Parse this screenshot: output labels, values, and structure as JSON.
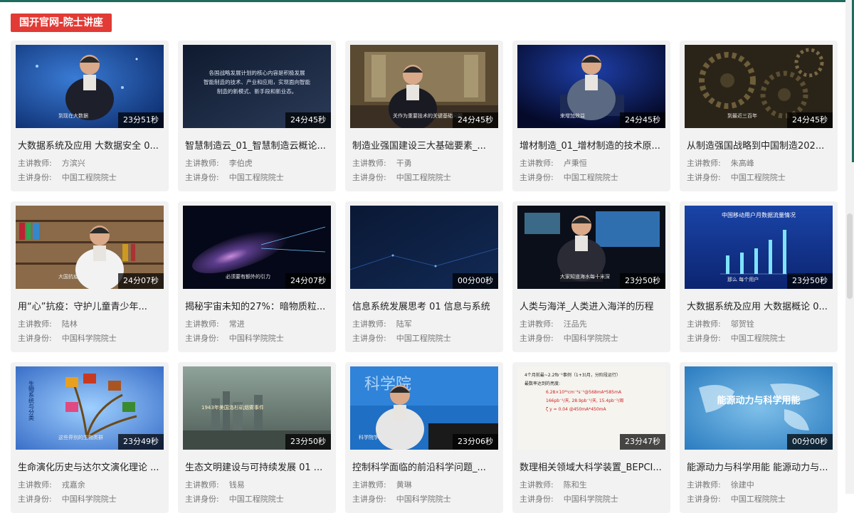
{
  "section": {
    "title": "国开官网-院士讲座"
  },
  "labels": {
    "teacher": "主讲教师:",
    "identity": "主讲身份:"
  },
  "videos": [
    {
      "title": "大数据系统及应用 大数据安全 0...",
      "teacher": "方滨兴",
      "identity": "中国工程院院士",
      "duration": "23分51秒",
      "caption": "到现在大数据",
      "scene": "anchor-blue"
    },
    {
      "title": "智慧制造云_01_智慧制造云概论...",
      "teacher": "李伯虎",
      "identity": "中国工程院院士",
      "duration": "24分45秒",
      "scene": "text-dark",
      "overlay_lines": [
        "各国战略发展计划的核心内容是积极发展",
        "智能制造的技术、产业和应用，实现面向智能",
        "制造的新模式、新手段和新业态。"
      ]
    },
    {
      "title": "制造业强国建设三大基础要素_...",
      "teacher": "干勇",
      "identity": "中国工程院院士",
      "duration": "24分45秒",
      "caption": "关作为重要技术的关键基础问题",
      "scene": "interview-hall"
    },
    {
      "title": "增材制造_01_增材制造的技术原...",
      "teacher": "卢秉恒",
      "identity": "中国工程院院士",
      "duration": "24分45秒",
      "caption": "来增加效益",
      "scene": "studio-blue"
    },
    {
      "title": "从制造强国战略到中国制造202...",
      "teacher": "朱高峰",
      "identity": "中国工程院院士",
      "duration": "24分45秒",
      "caption": "到最近三百年",
      "scene": "gears"
    },
    {
      "title": "用“心”抗疫：守护儿童青少年...",
      "teacher": "陆林",
      "identity": "中国科学院院士",
      "duration": "24分07秒",
      "caption": "大国抗疫",
      "scene": "library"
    },
    {
      "title": "揭秘宇宙未知的27%：暗物质粒...",
      "teacher": "常进",
      "identity": "中国科学院院士",
      "duration": "24分07秒",
      "caption": "必须要有额外的引力",
      "scene": "galaxy"
    },
    {
      "title": "信息系统发展思考 01 信息与系统",
      "teacher": "陆军",
      "identity": "中国工程院院士",
      "duration": "00分00秒",
      "scene": "dark-blue"
    },
    {
      "title": "人类与海洋_人类进入海洋的历程",
      "teacher": "汪品先",
      "identity": "中国科学院院士",
      "duration": "23分50秒",
      "caption": "大家知道海水每十米深",
      "scene": "stage-ocean"
    },
    {
      "title": "大数据系统及应用 大数据概论 0...",
      "teacher": "邬贺铨",
      "identity": "中国工程院院士",
      "duration": "23分50秒",
      "caption": "那么 每个用户",
      "scene": "bar-chart",
      "overlay_title": "中国移动用户月数据流量情况"
    },
    {
      "title": "生命演化历史与达尔文演化理论 ...",
      "teacher": "戎嘉余",
      "identity": "中国科学院院士",
      "duration": "23分49秒",
      "caption": "这些界别的生物类群",
      "scene": "life-tree",
      "overlay_lines": [
        "生物系统与分类"
      ]
    },
    {
      "title": "生态文明建设与可持续发展 01 ...",
      "teacher": "钱易",
      "identity": "中国工程院院士",
      "duration": "23分50秒",
      "caption": "1943年美国洛杉矶烟雾事件",
      "scene": "smog-city"
    },
    {
      "title": "控制科学面临的前沿科学问题_...",
      "teacher": "黄琳",
      "identity": "中国科学院院士",
      "duration": "23分06秒",
      "caption": "科学院学部",
      "scene": "podium"
    },
    {
      "title": "数理相关领域大科学装置_BEPCI...",
      "teacher": "陈和生",
      "identity": "中国科学院院士",
      "duration": "23分47秒",
      "scene": "slide-white",
      "overlay_lines": [
        "4个月前最~2.2fb⁻¹事例（1+3)月，分阶段运行）",
        "最数率达到的亮度:",
        "6.28×10³²cm⁻²s⁻¹@568mA*585mA",
        "166pb⁻¹/天, 28.9pb⁻¹/天, 15.4pb⁻¹/周",
        "ζ y = 0.04 @450mA*450mA"
      ]
    },
    {
      "title": "能源动力与科学用能 能源动力与...",
      "teacher": "徐建中",
      "identity": "中国工程院院士",
      "duration": "00分00秒",
      "caption": "能源动力与科学用能",
      "scene": "world-map"
    }
  ]
}
